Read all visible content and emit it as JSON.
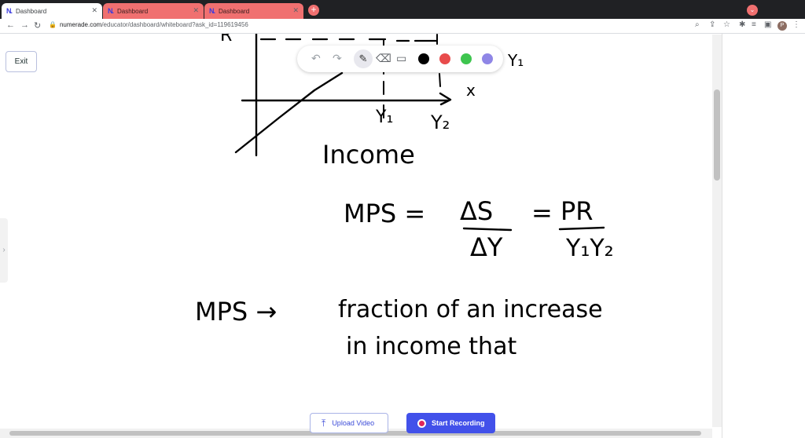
{
  "browser": {
    "tabs": [
      {
        "label": "Dashboard"
      },
      {
        "label": "Dashboard"
      },
      {
        "label": "Dashboard"
      }
    ],
    "url_host": "numerade.com",
    "url_path": "/educator/dashboard/whiteboard?ask_id=119619456",
    "profile_initial": "P"
  },
  "whiteboard": {
    "exit_label": "Exit",
    "tools": [
      "undo-icon",
      "redo-icon",
      "pen-icon",
      "eraser-icon",
      "image-icon"
    ],
    "colors": [
      "#000000",
      "#e84b4b",
      "#3ec54f",
      "#8f86e6"
    ],
    "handwriting": {
      "y_label_1": "Y₁",
      "y_label_2": "Y₂",
      "x_axis_label": "x",
      "x_axis_title": "Income",
      "right_label": "Y₁",
      "mps_lhs": "MPS =",
      "delta_s": "ΔS",
      "delta_y": "ΔY",
      "eq": "=",
      "pr": "PR",
      "y1y2": "Y₁Y₂",
      "definition_line1_a": "MPS →",
      "definition_line1_b": "fraction of an increase",
      "definition_line2": "in income that",
      "corner_label": "R"
    }
  },
  "footer": {
    "upload_label": "Upload Video",
    "record_label": "Start Recording"
  }
}
